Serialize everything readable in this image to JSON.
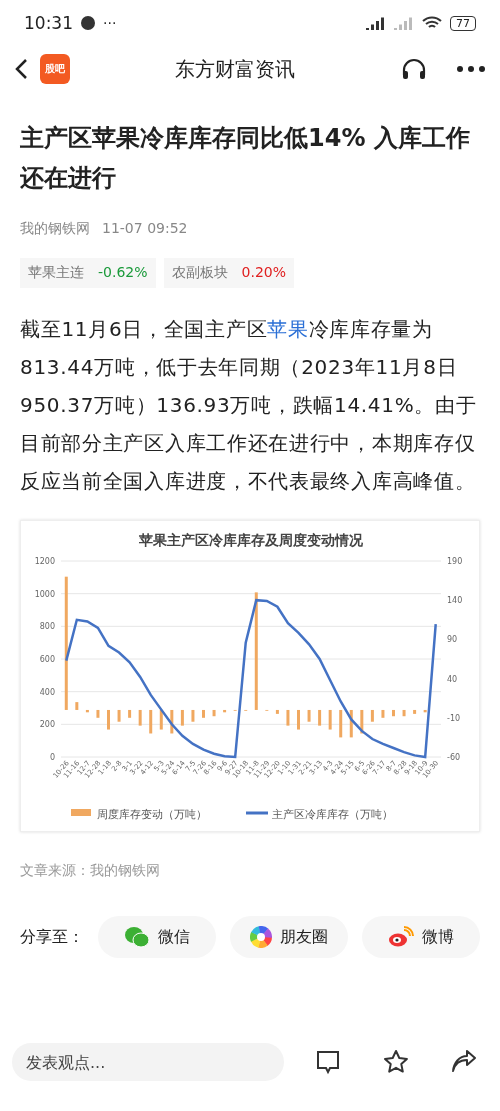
{
  "status_bar": {
    "time": "10:31",
    "dots": "···",
    "battery": "77"
  },
  "header": {
    "title": "东方财富资讯",
    "app_badge": "股吧"
  },
  "article": {
    "title": "主产区苹果冷库库存同比低14% 入库工作还在进行",
    "source": "我的钢铁网",
    "time": "11-07 09:52",
    "quotes": [
      {
        "name": "苹果主连",
        "change": "-0.62%",
        "color": "#1a9a3a"
      },
      {
        "name": "农副板块",
        "change": "0.20%",
        "color": "#e02020"
      }
    ],
    "body": [
      {
        "kind": "plain",
        "text": "截至11月6日，全国主产区"
      },
      {
        "kind": "link",
        "text": "苹果"
      },
      {
        "kind": "plain",
        "text": "冷库库存量为813.44万吨，低于去年同期（2023年11月8日950.37万吨）136.93万吨，跌幅14.41%。由于目前部分主产区入库工作还在进行中，本期库存仅反应当前全国入库进度，不代表最终入库高峰值。"
      }
    ],
    "chart_data": {
      "type": "bar",
      "title": "苹果主产区冷库库存及周度变动情况",
      "categories": [
        "10-26",
        "11-16",
        "12-7",
        "12-28",
        "1-18",
        "2-8",
        "3-1",
        "3-22",
        "4-12",
        "5-3",
        "5-24",
        "6-14",
        "7-5",
        "7-26",
        "8-16",
        "9-6",
        "9-27",
        "10-18",
        "11-8",
        "11-29",
        "12-20",
        "1-10",
        "1-31",
        "2-21",
        "3-13",
        "4-3",
        "4-24",
        "5-15",
        "6-5",
        "6-26",
        "7-17",
        "8-7",
        "8-28",
        "9-18",
        "10-9",
        "10-30"
      ],
      "yticks": [
        0,
        200,
        400,
        600,
        800,
        1000,
        1200
      ],
      "ylim": [
        0,
        1200
      ],
      "y2ticks": [
        -60,
        -10,
        40,
        90,
        140,
        190
      ],
      "grid": true,
      "legend": "bottom",
      "y2lim": [
        -60,
        190
      ],
      "series": [
        {
          "name": "周度库存变动（万吨）",
          "color": "#f0a860",
          "type": "bar",
          "axis": "y2",
          "values": [
            170,
            10,
            -3,
            -10,
            -25,
            -15,
            -10,
            -20,
            -30,
            -25,
            -30,
            -20,
            -15,
            -10,
            -8,
            -3,
            0,
            0,
            150,
            0,
            -5,
            -20,
            -25,
            -15,
            -20,
            -25,
            -35,
            -35,
            -30,
            -15,
            -10,
            -8,
            -8,
            -5,
            -3,
            null
          ]
        },
        {
          "name": "主产区冷库库存（万吨）",
          "color": "#4472c4",
          "type": "line",
          "values": [
            590,
            840,
            830,
            790,
            680,
            640,
            580,
            490,
            380,
            290,
            200,
            130,
            80,
            45,
            20,
            5,
            0,
            700,
            960,
            955,
            920,
            820,
            760,
            690,
            600,
            470,
            340,
            230,
            160,
            110,
            80,
            55,
            30,
            10,
            0,
            813
          ]
        }
      ]
    },
    "footer_source": "文章来源：我的钢铁网"
  },
  "share": {
    "label": "分享至：",
    "targets": [
      {
        "kind": "wechat",
        "label": "微信"
      },
      {
        "kind": "moments",
        "label": "朋友圈"
      },
      {
        "kind": "weibo",
        "label": "微博"
      }
    ]
  },
  "bottom_bar": {
    "placeholder": "发表观点..."
  }
}
